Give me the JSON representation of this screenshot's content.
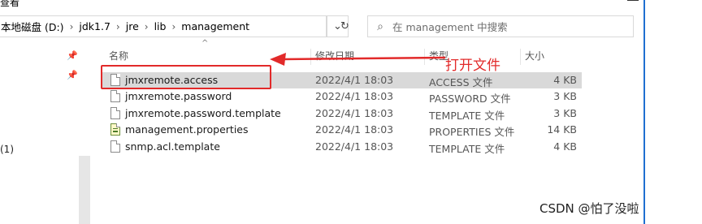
{
  "window": {
    "title_fragment": "查看"
  },
  "address_bar": {
    "segments": [
      "本地磁盘 (D:)",
      "jdk1.7",
      "jre",
      "lib",
      "management"
    ],
    "separator": "›",
    "dropdown_glyph": "⌄",
    "refresh_glyph": "↻"
  },
  "search": {
    "placeholder": "在 management 中搜索",
    "icon_glyph": "⌕"
  },
  "nav_pane": {
    "pin_glyph": "📌",
    "item_fragment": "(1)"
  },
  "columns": {
    "name": "名称",
    "date": "修改日期",
    "type": "类型",
    "size": "大小"
  },
  "files": [
    {
      "name": "jmxremote.access",
      "date": "2022/4/1 18:03",
      "type": "ACCESS 文件",
      "size": "4 KB",
      "icon": "document-icon",
      "selected": true
    },
    {
      "name": "jmxremote.password",
      "date": "2022/4/1 18:03",
      "type": "PASSWORD 文件",
      "size": "3 KB",
      "icon": "document-icon",
      "selected": false
    },
    {
      "name": "jmxremote.password.template",
      "date": "2022/4/1 18:03",
      "type": "TEMPLATE 文件",
      "size": "3 KB",
      "icon": "document-icon",
      "selected": false
    },
    {
      "name": "management.properties",
      "date": "2022/4/1 18:03",
      "type": "PROPERTIES 文件",
      "size": "14 KB",
      "icon": "properties-file-icon",
      "selected": false
    },
    {
      "name": "snmp.acl.template",
      "date": "2022/4/1 18:03",
      "type": "TEMPLATE 文件",
      "size": "4 KB",
      "icon": "document-icon",
      "selected": false
    }
  ],
  "annotation": {
    "text": "打开文件",
    "color": "#e22a2a"
  },
  "watermark": "CSDN @怕了没啦",
  "colors": {
    "selection": "#d9d9d9",
    "accent_edge": "#1f6fd1"
  }
}
